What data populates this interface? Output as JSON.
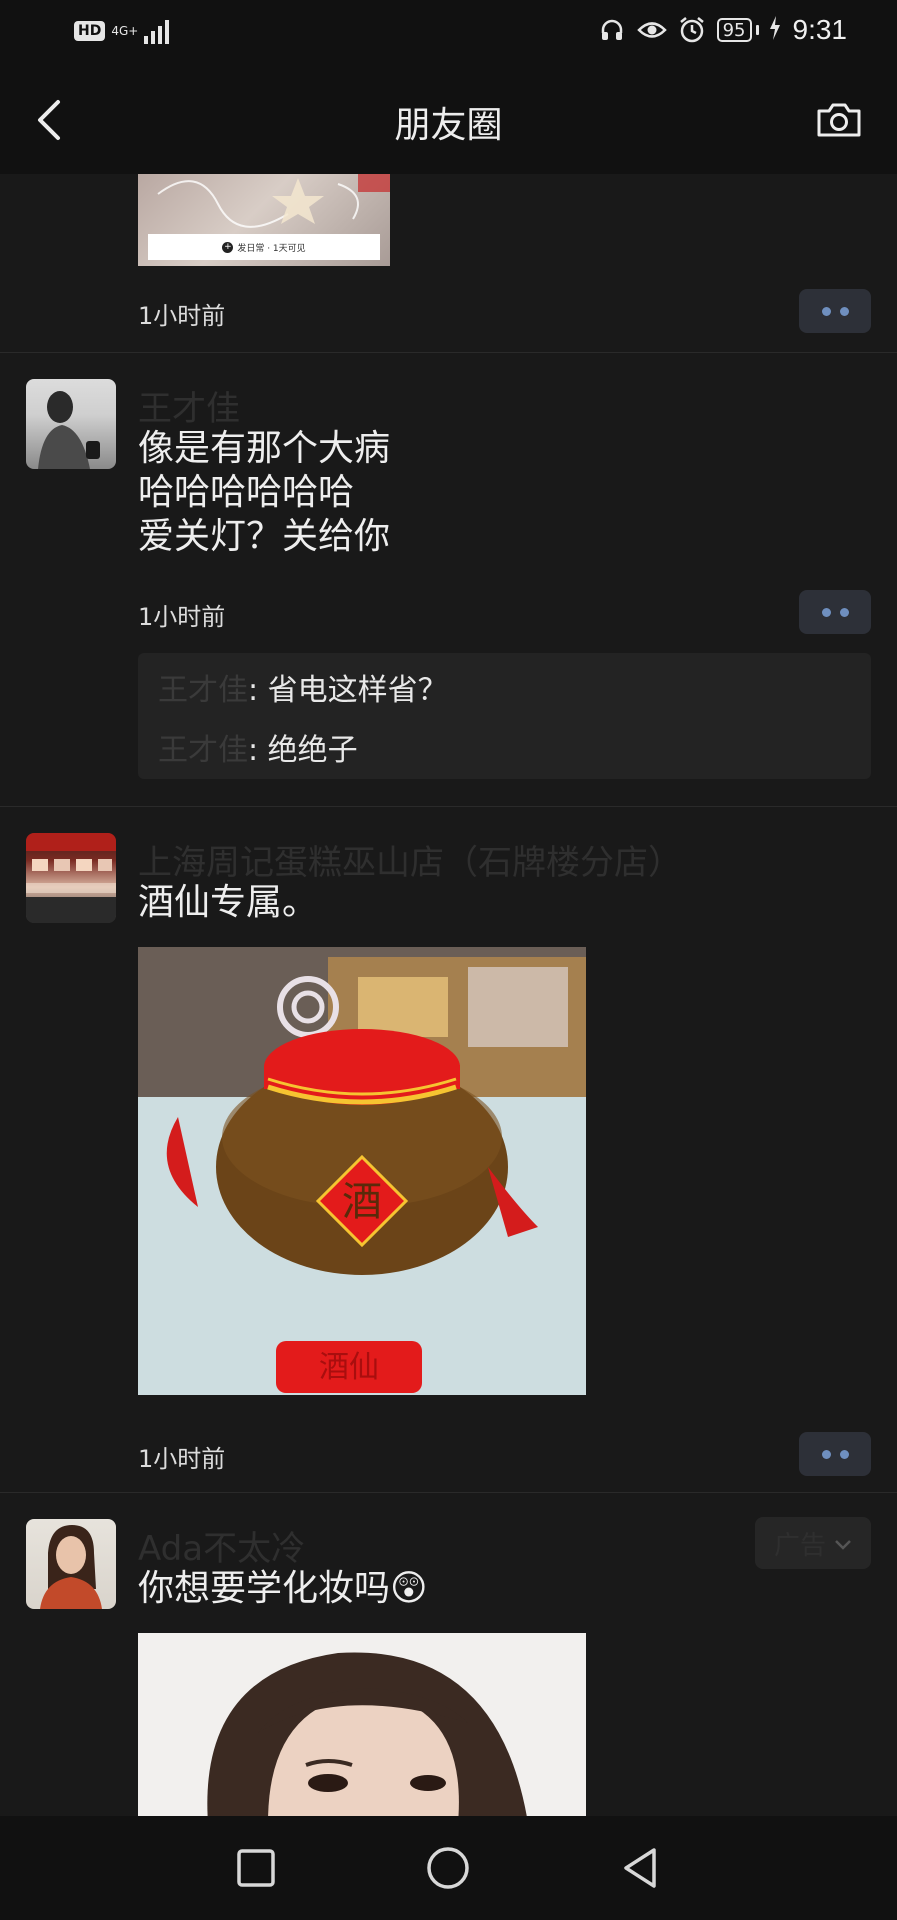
{
  "status_bar": {
    "hd": "HD",
    "network": "4G+",
    "battery": "95",
    "time": "9:31",
    "icons": [
      "headphone-icon",
      "eye-icon",
      "alarm-icon",
      "charging-icon"
    ]
  },
  "nav": {
    "title": "朋友圈",
    "back_icon": "chevron-left-icon",
    "camera_icon": "camera-icon"
  },
  "posts": [
    {
      "image_caption": "发日常 · 1天可见",
      "time": "1小时前"
    },
    {
      "name": "王才佳",
      "lines": [
        "像是有那个大病",
        "哈哈哈哈哈哈",
        "爱关灯？关给你"
      ],
      "time": "1小时前",
      "comments": [
        {
          "name": "王才佳",
          "sep": ": ",
          "text": "省电这样省？"
        },
        {
          "name": "王才佳",
          "sep": ": ",
          "text": "绝绝子"
        }
      ]
    },
    {
      "name": "上海周记蛋糕巫山店（石牌楼分店）",
      "text": "酒仙专属。",
      "image_text": {
        "center": "酒",
        "bottom": "酒仙"
      },
      "time": "1小时前"
    },
    {
      "name": "Ada不太冷",
      "text": "你想要学化妆吗😲",
      "ad_label": "广告"
    }
  ],
  "colors": {
    "background": "#191919",
    "bar": "#111111",
    "name_text": "#2f2f2f",
    "more_dots": "#6f8fbf"
  }
}
